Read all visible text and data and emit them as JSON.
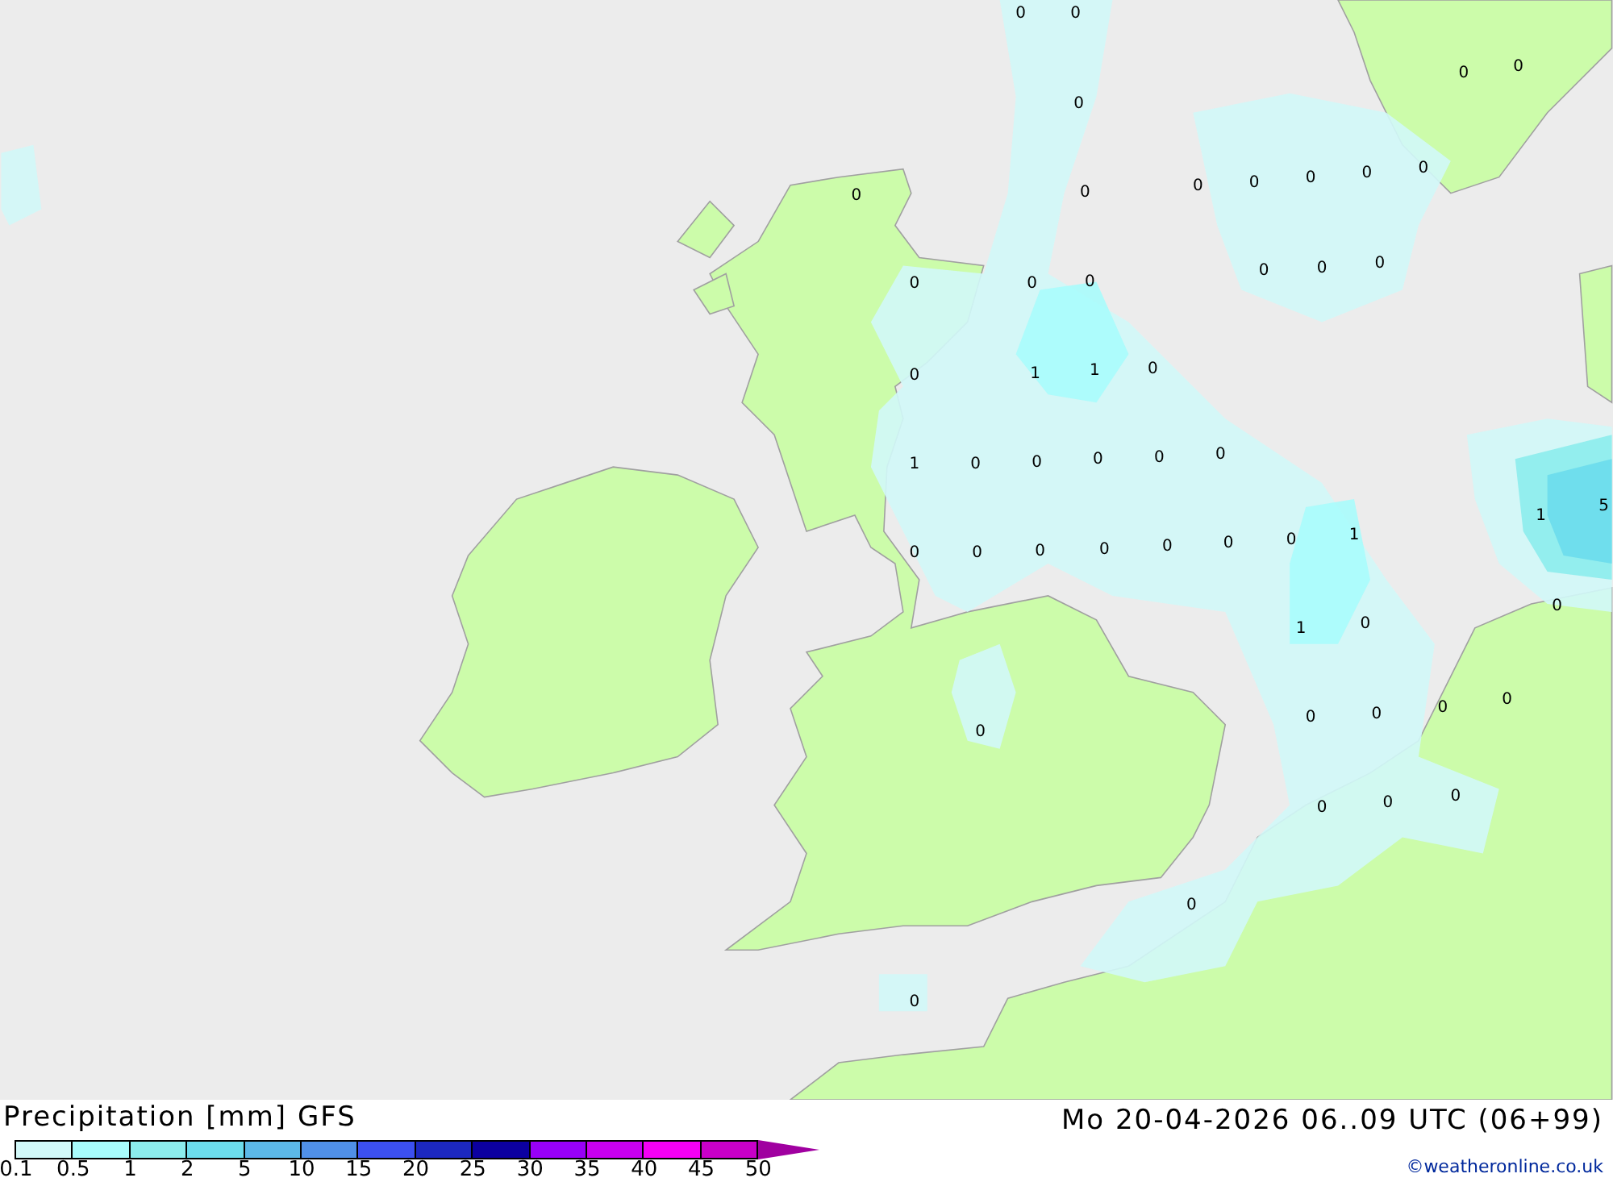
{
  "map": {
    "labels": [
      "0",
      "0",
      "0",
      "0",
      "0",
      "0",
      "0",
      "0",
      "0",
      "0",
      "0",
      "0",
      "0",
      "0",
      "0",
      "0",
      "0",
      "0",
      "0",
      "1",
      "1",
      "0",
      "1",
      "0",
      "0",
      "0",
      "0",
      "0",
      "1",
      "5",
      "0",
      "0",
      "0",
      "0",
      "0",
      "0",
      "0",
      "1",
      "0",
      "1",
      "0",
      "0",
      "0",
      "0",
      "0",
      "0",
      "0",
      "0",
      "0",
      "0",
      "0"
    ]
  },
  "footer": {
    "title": "Precipitation [mm] GFS",
    "datetime": "Mo 20-04-2026 06..09 UTC (06+99)",
    "credit": "©weatheronline.co.uk"
  },
  "legend": {
    "bins": [
      {
        "kind": "swatch",
        "color": "#d2f8f8"
      },
      {
        "kind": "swatch",
        "color": "#a8fcfc"
      },
      {
        "kind": "swatch",
        "color": "#8cecec"
      },
      {
        "kind": "swatch",
        "color": "#6cdcec"
      },
      {
        "kind": "swatch",
        "color": "#5cb8e8"
      },
      {
        "kind": "swatch",
        "color": "#5090e8"
      },
      {
        "kind": "swatch",
        "color": "#3c50f0"
      },
      {
        "kind": "swatch",
        "color": "#1c28c0"
      },
      {
        "kind": "swatch",
        "color": "#0c00a0"
      },
      {
        "kind": "swatch",
        "color": "#9800f8"
      },
      {
        "kind": "swatch",
        "color": "#c800f0"
      },
      {
        "kind": "swatch",
        "color": "#f400f4"
      },
      {
        "kind": "swatch",
        "color": "#c800c8"
      },
      {
        "kind": "arrow",
        "color": "#a000a0"
      }
    ],
    "ticks": [
      "0.1",
      "0.5",
      "1",
      "2",
      "5",
      "10",
      "15",
      "20",
      "25",
      "30",
      "35",
      "40",
      "45",
      "50"
    ]
  }
}
